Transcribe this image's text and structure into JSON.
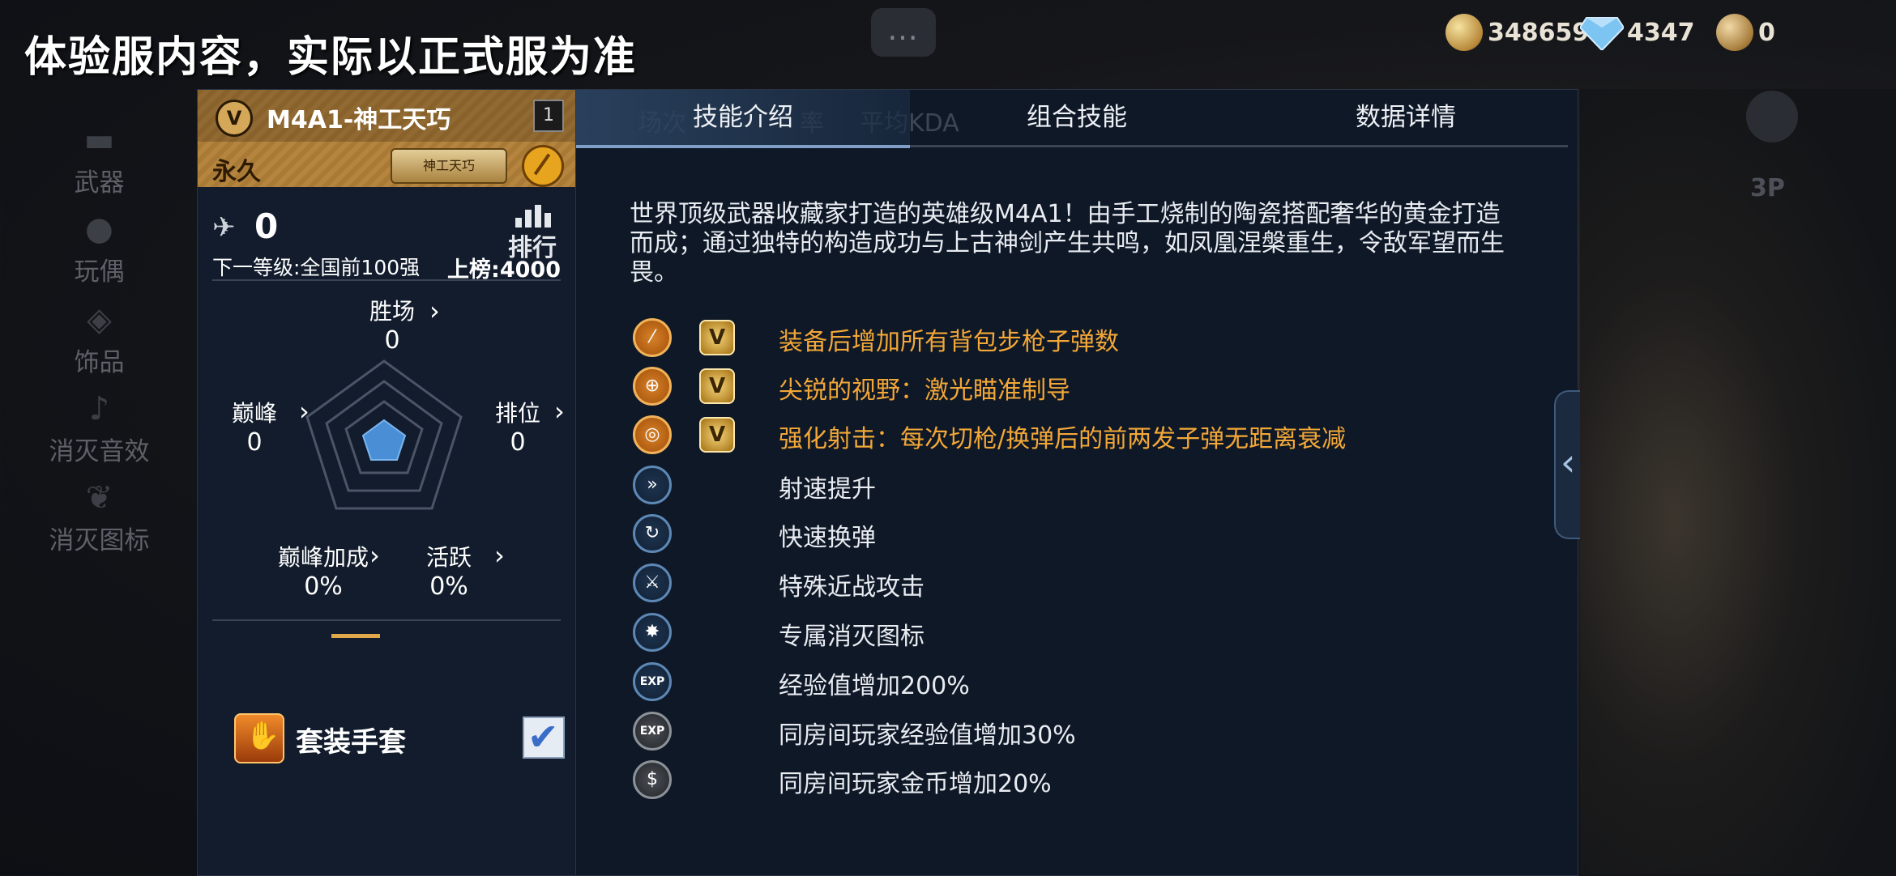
{
  "banner": "体验服内容，实际以正式服为准",
  "currency": {
    "gold_value": "348659",
    "diamond_value": "4347",
    "token_value": "0"
  },
  "left_nav": [
    {
      "label": "武器"
    },
    {
      "label": "玩偶"
    },
    {
      "label": "饰品"
    },
    {
      "label": "消灭音效"
    },
    {
      "label": "消灭图标"
    }
  ],
  "weapon": {
    "name": "M4A1-神工天巧",
    "badge": "V",
    "count": "1",
    "duration": "永久",
    "tag": "神工天巧"
  },
  "rank": {
    "value": "0",
    "next_level": "下一等级:全国前100强",
    "on_board": "上榜:4000",
    "rank_button": "排行"
  },
  "stats": {
    "wins_label": "胜场",
    "wins_value": "0",
    "peak_label": "巅峰",
    "peak_value": "0",
    "rank_label": "排位",
    "rank_value": "0",
    "peak_bonus_label": "巅峰加成",
    "peak_bonus_value": "0%",
    "active_label": "活跃",
    "active_value": "0%"
  },
  "gloves": {
    "label": "套装手套"
  },
  "tabs": {
    "skills": "技能介绍",
    "combo": "组合技能",
    "details": "数据详情",
    "ghost_matches": "场次",
    "ghost_rate": "率",
    "ghost_kda": "平均KDA"
  },
  "description": "世界顶级武器收藏家打造的英雄级M4A1！由手工烧制的陶瓷搭配奢华的黄金打造而成；通过独特的构造成功与上古神剑产生共鸣，如凤凰涅槃重生，令敌军望而生畏。",
  "skills": [
    {
      "text": "装备后增加所有背包步枪子弹数",
      "style": "gold",
      "v": "V"
    },
    {
      "text": "尖锐的视野：激光瞄准制导",
      "style": "gold",
      "v": "V"
    },
    {
      "text": "强化射击：每次切枪/换弹后的前两发子弹无距离衰减",
      "style": "gold",
      "v": "V"
    },
    {
      "text": "射速提升",
      "style": "blue"
    },
    {
      "text": "快速换弹",
      "style": "blue"
    },
    {
      "text": "特殊近战攻击",
      "style": "blue"
    },
    {
      "text": "专属消灭图标",
      "style": "blue"
    },
    {
      "text": "经验值增加200%",
      "style": "blue",
      "icon_text": "EXP"
    },
    {
      "text": "同房间玩家经验值增加30%",
      "style": "grey",
      "icon_text": "EXP"
    },
    {
      "text": "同房间玩家金币增加20%",
      "style": "grey"
    }
  ],
  "side": {
    "view_label": "3P"
  },
  "colors": {
    "accent_gold": "#f3a737",
    "panel_bg": "#0e1827",
    "tab_active": "#2e4766"
  }
}
